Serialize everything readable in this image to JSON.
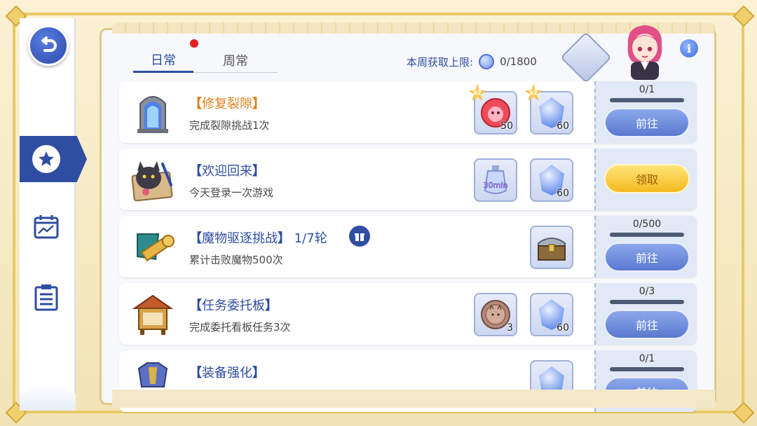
{
  "tabs": [
    {
      "label": "日常",
      "active": true,
      "has_notification": true
    },
    {
      "label": "周常",
      "active": false
    }
  ],
  "weekly_limit": {
    "label": "本周获取上限:",
    "value": "0/1800"
  },
  "info_label": "i",
  "tasks": [
    {
      "title_open": "【",
      "title": "修复裂隙",
      "title_close": "】",
      "extra": "",
      "description": "完成裂隙挑战1次",
      "highlight": true,
      "icon": "portal-gate-icon",
      "rewards": [
        {
          "icon": "pink-potion-icon",
          "qty": "50",
          "multiplier": "x2"
        },
        {
          "icon": "blue-crystal-icon",
          "qty": "60",
          "multiplier": "x2"
        }
      ],
      "progress": "0/1",
      "action": "前往"
    },
    {
      "title_open": "【",
      "title": "欢迎回来",
      "title_close": "】",
      "extra": "",
      "description": "今天登录一次游戏",
      "highlight": false,
      "icon": "cat-picture-icon",
      "rewards": [
        {
          "icon": "potion-30min-icon",
          "qty": "",
          "label": "30min"
        },
        {
          "icon": "blue-crystal-icon",
          "qty": "60"
        }
      ],
      "progress": "",
      "action": "领取"
    },
    {
      "title_open": "【",
      "title": "魔物驱逐挑战",
      "title_close": "】",
      "extra": "1/7轮",
      "description": "累计击败魔物500次",
      "highlight": false,
      "icon": "horn-banner-icon",
      "rewards": [
        {
          "icon": "treasure-chest-icon",
          "qty": ""
        }
      ],
      "progress": "0/500",
      "action": "前往"
    },
    {
      "title_open": "【",
      "title": "任务委托板",
      "title_close": "】",
      "extra": "",
      "description": "完成委托看板任务3次",
      "highlight": false,
      "icon": "notice-board-icon",
      "rewards": [
        {
          "icon": "cat-coin-icon",
          "qty": "3"
        },
        {
          "icon": "blue-crystal-icon",
          "qty": "60"
        }
      ],
      "progress": "0/3",
      "action": "前往"
    },
    {
      "title_open": "【",
      "title": "装备强化",
      "title_close": "】",
      "extra": "",
      "description": "",
      "highlight": false,
      "icon": "armor-icon",
      "rewards": [
        {
          "icon": "blue-crystal-icon",
          "qty": ""
        }
      ],
      "progress": "0/1",
      "action": "前往"
    }
  ],
  "colors": {
    "accent": "#2f4da3",
    "highlight_title": "#e0801a",
    "claim": "#f4b91f"
  }
}
